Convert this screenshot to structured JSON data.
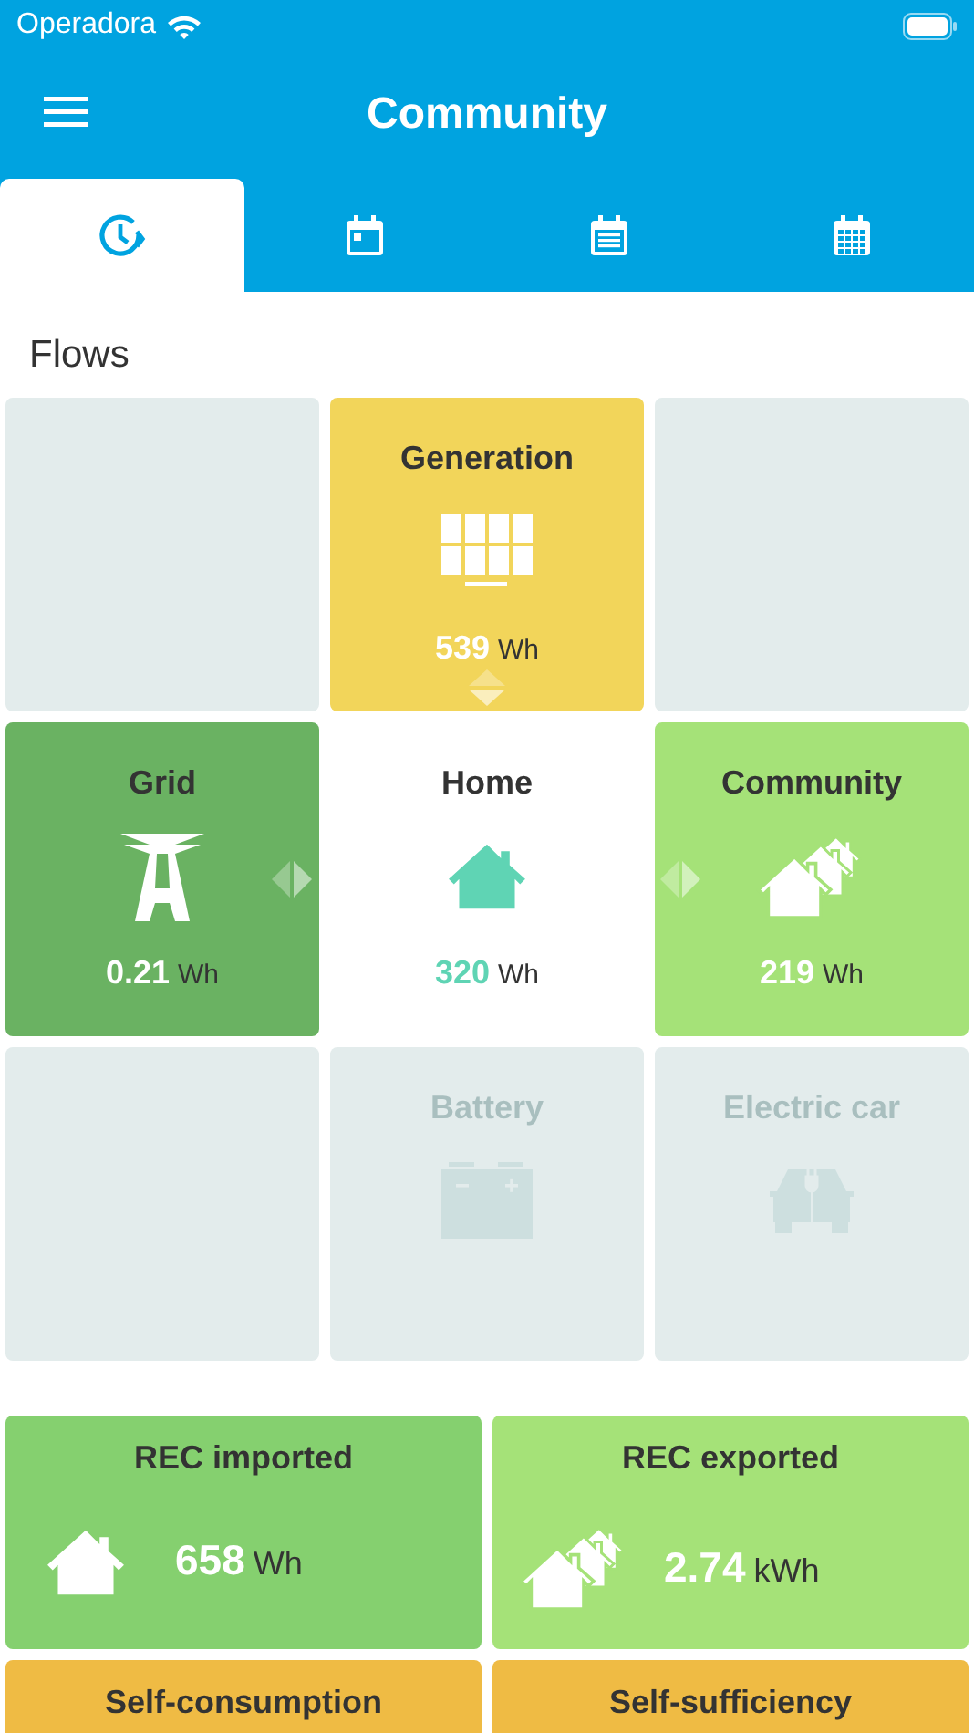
{
  "status_bar": {
    "carrier": "Operadora"
  },
  "header": {
    "title": "Community"
  },
  "tabs": [
    {
      "kind": "clock",
      "selected": true
    },
    {
      "kind": "day",
      "selected": false
    },
    {
      "kind": "week",
      "selected": false
    },
    {
      "kind": "month",
      "selected": false
    }
  ],
  "section_title": "Flows",
  "flow_tiles": [
    {
      "kind": "empty"
    },
    {
      "kind": "generation",
      "title": "Generation",
      "value": "539",
      "unit": "Wh"
    },
    {
      "kind": "empty"
    },
    {
      "kind": "grid",
      "title": "Grid",
      "value": "0.21",
      "unit": "Wh"
    },
    {
      "kind": "home",
      "title": "Home",
      "value": "320",
      "unit": "Wh"
    },
    {
      "kind": "community",
      "title": "Community",
      "value": "219",
      "unit": "Wh"
    },
    {
      "kind": "empty"
    },
    {
      "kind": "battery",
      "title": "Battery",
      "disabled": true
    },
    {
      "kind": "car",
      "title": "Electric car",
      "disabled": true
    }
  ],
  "summary_cards": [
    {
      "kind": "imported",
      "title": "REC imported",
      "value": "658",
      "unit": "Wh"
    },
    {
      "kind": "exported",
      "title": "REC exported",
      "value": "2.74",
      "unit": "kWh"
    },
    {
      "kind": "self",
      "title": "Self-consumption"
    },
    {
      "kind": "self",
      "title": "Self-sufficiency"
    }
  ]
}
